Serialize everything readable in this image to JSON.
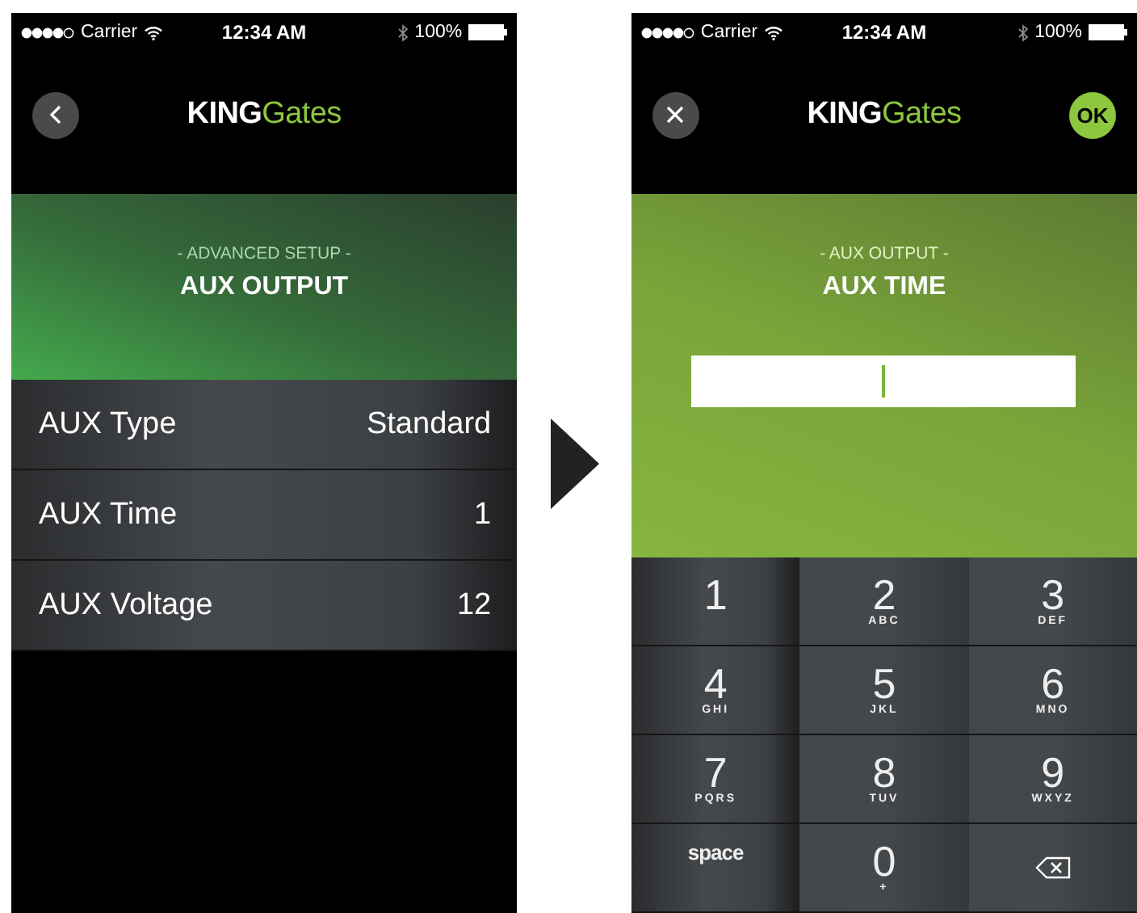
{
  "screens": [
    {
      "status_bar": {
        "carrier": "Carrier",
        "time": "12:34 AM",
        "battery": "100%"
      },
      "header": {
        "left_button": {
          "kind": "back"
        },
        "logo_bold": "KING",
        "logo_light": "Gates"
      },
      "banner": {
        "subtitle": "- ADVANCED SETUP -",
        "title": "AUX OUTPUT"
      },
      "settings": [
        {
          "label": "AUX Type",
          "value": "Standard"
        },
        {
          "label": "AUX Time",
          "value": "1"
        },
        {
          "label": "AUX Voltage",
          "value": "12"
        }
      ]
    },
    {
      "status_bar": {
        "carrier": "Carrier",
        "time": "12:34 AM",
        "battery": "100%"
      },
      "header": {
        "left_button": {
          "kind": "close"
        },
        "logo_bold": "KING",
        "logo_light": "Gates",
        "ok_button": "OK"
      },
      "banner": {
        "subtitle": "- AUX OUTPUT -",
        "title": "AUX TIME",
        "input": {
          "focused": true
        }
      },
      "keypad": [
        {
          "kind": "digit",
          "digit": "1"
        },
        {
          "kind": "digit",
          "digit": "2",
          "letters": "ABC"
        },
        {
          "kind": "digit",
          "digit": "3",
          "letters": "DEF"
        },
        {
          "kind": "digit",
          "digit": "4",
          "letters": "GHI"
        },
        {
          "kind": "digit",
          "digit": "5",
          "letters": "JKL"
        },
        {
          "kind": "digit",
          "digit": "6",
          "letters": "MNO"
        },
        {
          "kind": "digit",
          "digit": "7",
          "letters": "PQRS"
        },
        {
          "kind": "digit",
          "digit": "8",
          "letters": "TUV"
        },
        {
          "kind": "digit",
          "digit": "9",
          "letters": "WXYZ"
        },
        {
          "kind": "space",
          "label": "space"
        },
        {
          "kind": "digit",
          "digit": "0",
          "letters": "+"
        },
        {
          "kind": "delete"
        }
      ]
    }
  ]
}
